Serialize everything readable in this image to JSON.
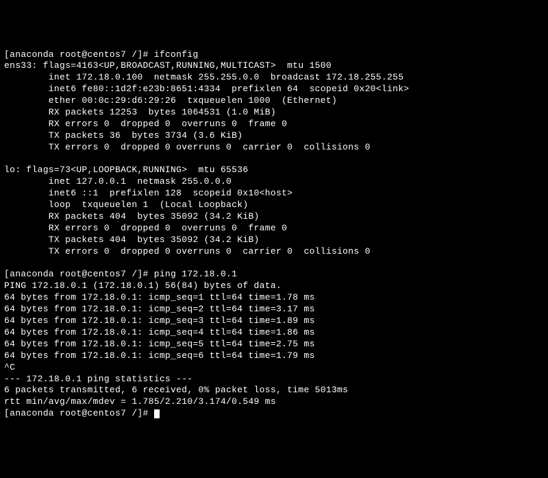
{
  "prompt1": "[anaconda root@centos7 /]# ifconfig",
  "ifconfig": {
    "ens33": {
      "line1": "ens33: flags=4163<UP,BROADCAST,RUNNING,MULTICAST>  mtu 1500",
      "line2": "        inet 172.18.0.100  netmask 255.255.0.0  broadcast 172.18.255.255",
      "line3": "        inet6 fe80::1d2f:e23b:8651:4334  prefixlen 64  scopeid 0x20<link>",
      "line4": "        ether 00:0c:29:d6:29:26  txqueuelen 1000  (Ethernet)",
      "line5": "        RX packets 12253  bytes 1064531 (1.0 MiB)",
      "line6": "        RX errors 0  dropped 0  overruns 0  frame 0",
      "line7": "        TX packets 36  bytes 3734 (3.6 KiB)",
      "line8": "        TX errors 0  dropped 0 overruns 0  carrier 0  collisions 0"
    },
    "lo": {
      "line1": "lo: flags=73<UP,LOOPBACK,RUNNING>  mtu 65536",
      "line2": "        inet 127.0.0.1  netmask 255.0.0.0",
      "line3": "        inet6 ::1  prefixlen 128  scopeid 0x10<host>",
      "line4": "        loop  txqueuelen 1  (Local Loopback)",
      "line5": "        RX packets 404  bytes 35092 (34.2 KiB)",
      "line6": "        RX errors 0  dropped 0  overruns 0  frame 0",
      "line7": "        TX packets 404  bytes 35092 (34.2 KiB)",
      "line8": "        TX errors 0  dropped 0 overruns 0  carrier 0  collisions 0"
    }
  },
  "prompt2": "[anaconda root@centos7 /]# ping 172.18.0.1",
  "ping": {
    "header": "PING 172.18.0.1 (172.18.0.1) 56(84) bytes of data.",
    "r1": "64 bytes from 172.18.0.1: icmp_seq=1 ttl=64 time=1.78 ms",
    "r2": "64 bytes from 172.18.0.1: icmp_seq=2 ttl=64 time=3.17 ms",
    "r3": "64 bytes from 172.18.0.1: icmp_seq=3 ttl=64 time=1.89 ms",
    "r4": "64 bytes from 172.18.0.1: icmp_seq=4 ttl=64 time=1.86 ms",
    "r5": "64 bytes from 172.18.0.1: icmp_seq=5 ttl=64 time=2.75 ms",
    "r6": "64 bytes from 172.18.0.1: icmp_seq=6 ttl=64 time=1.79 ms",
    "interrupt": "^C",
    "stats_header": "--- 172.18.0.1 ping statistics ---",
    "stats_line1": "6 packets transmitted, 6 received, 0% packet loss, time 5013ms",
    "stats_line2": "rtt min/avg/max/mdev = 1.785/2.210/3.174/0.549 ms"
  },
  "prompt3": "[anaconda root@centos7 /]# "
}
